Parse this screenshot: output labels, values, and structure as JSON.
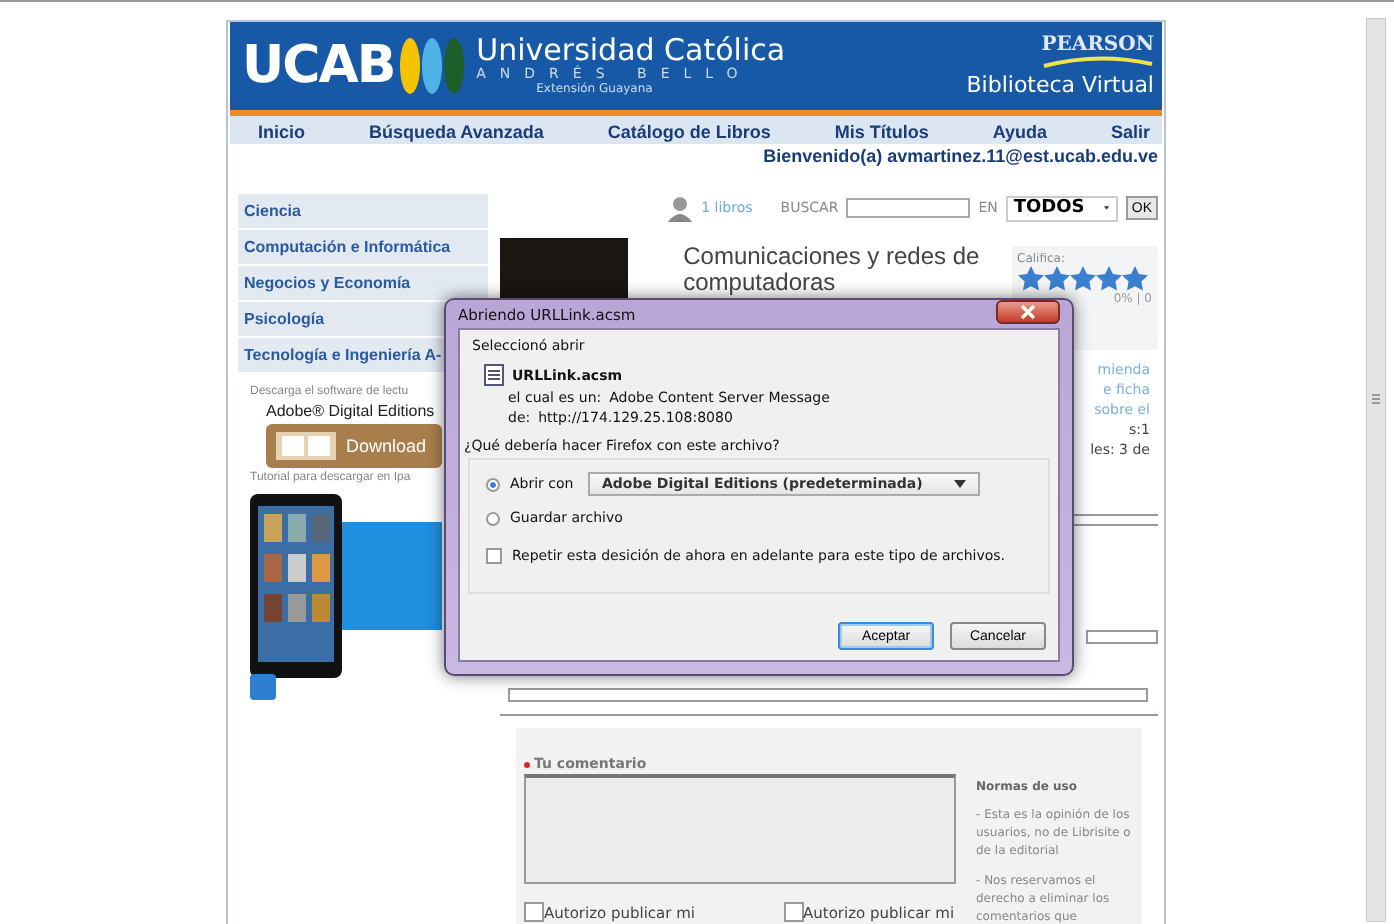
{
  "header": {
    "logo_text": "UCAB",
    "university": "Universidad Católica",
    "subtitle": "ANDRÉS BELLO",
    "campus": "Extensión Guayana",
    "publisher": "PEARSON",
    "library": "Biblioteca Virtual"
  },
  "nav": [
    "Inicio",
    "Búsqueda Avanzada",
    "Catálogo de Libros",
    "Mis Títulos",
    "Ayuda",
    "Salir"
  ],
  "welcome": "Bienvenido(a) avmartinez.11@est.ucab.edu.ve",
  "categories": [
    "Ciencia",
    "Computación e Informática",
    "Negocios y Economía",
    "Psicología",
    "Tecnología e Ingeniería A-"
  ],
  "promo": {
    "download_note": "Descarga el software de lectu",
    "product": "Adobe® Digital Editions",
    "download_button": "Download",
    "tutorial_note": "Tutorial para descargar en Ipa"
  },
  "search": {
    "count": "1 libros",
    "label": "BUSCAR",
    "scope_label": "EN",
    "scope": "TODOS",
    "submit": "OK"
  },
  "book": {
    "title": "Comunicaciones y redes de computadoras",
    "rating_label": "Califica:",
    "stars": 5,
    "rating_summary": "0% | 0"
  },
  "side_fragments": [
    {
      "text": "mienda",
      "kind": "link"
    },
    {
      "text": "e ficha",
      "kind": "link"
    },
    {
      "text": "sobre el",
      "kind": "link"
    },
    {
      "text": "s:1",
      "kind": "plain"
    },
    {
      "text": "les: 3 de",
      "kind": "plain"
    }
  ],
  "comment": {
    "label": "Tu comentario",
    "rules_title": "Normas de uso",
    "rules": [
      "- Esta es la opinión de los usuarios, no de Librisite o de la editorial",
      "- Nos reservamos el derecho a eliminar los comentarios que"
    ],
    "consents": [
      {
        "label": "Autorizo publicar mi",
        "checked": false
      },
      {
        "label": "Autorizo publicar mi",
        "checked": false
      }
    ]
  },
  "dialog": {
    "title": "Abriendo URLLink.acsm",
    "intro": "Seleccionó abrir",
    "file_name": "URLLink.acsm",
    "type_label": "el cual es un:",
    "type": "Adobe Content Server Message",
    "source_label": "de:",
    "source": "http://174.129.25.108:8080",
    "question": "¿Qué debería hacer Firefox con este archivo?",
    "options": [
      {
        "kind": "open",
        "label": "Abrir con",
        "selected": true,
        "app": "Adobe Digital Editions (predeterminada)"
      },
      {
        "kind": "save",
        "label": "Guardar archivo",
        "selected": false
      }
    ],
    "remember": {
      "label": "Repetir esta desición de ahora en adelante para este tipo de archivos.",
      "checked": false
    },
    "buttons": [
      {
        "label": "Aceptar",
        "default": true
      },
      {
        "label": "Cancelar",
        "default": false
      }
    ]
  }
}
